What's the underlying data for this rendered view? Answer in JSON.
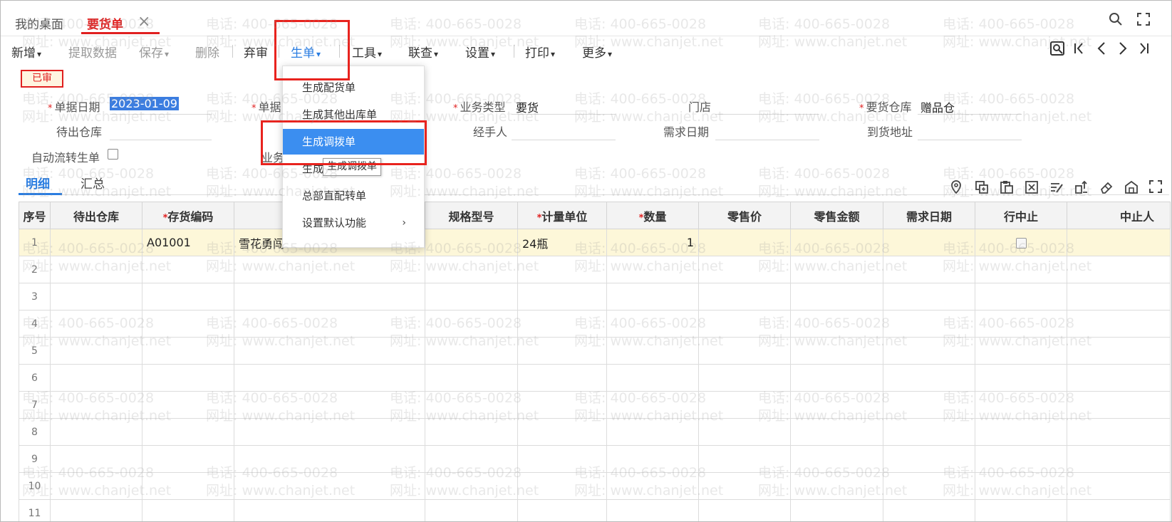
{
  "tabs": {
    "desktop": "我的桌面",
    "current": "要货单",
    "close_icon": "×",
    "search_icon": "search",
    "fullscreen_icon": "fullscreen"
  },
  "toolbar": {
    "add": "新增",
    "extract": "提取数据",
    "save": "保存",
    "delete": "删除",
    "unaudit": "弃审",
    "generate": "生单",
    "tools": "工具",
    "linked_query": "联查",
    "settings": "设置",
    "print": "打印",
    "more": "更多",
    "nav": [
      "preview",
      "first",
      "prev",
      "next",
      "last"
    ]
  },
  "status_badge": "已审",
  "form": {
    "doc_date_label": "单据日期",
    "doc_date_value": "2023-01-09",
    "doc_no_label": "单据",
    "biz_type_label": "业务类型",
    "biz_type_value": "要货",
    "store_label": "门店",
    "req_warehouse_label": "要货仓库",
    "req_warehouse_value": "赠品仓",
    "out_warehouse_label": "待出仓库",
    "handler_label": "经手人",
    "demand_date_label": "需求日期",
    "arrival_address_label": "到货地址",
    "auto_flow_label": "自动流转生单",
    "biz_partial_label": "业务"
  },
  "detail_tabs": [
    "明细",
    "汇总"
  ],
  "grid_icons": [
    "location-icon",
    "copy-row-icon",
    "paste-icon",
    "delete-row-icon",
    "batch-edit-icon",
    "split-icon",
    "eraser-icon",
    "warehouse-icon",
    "expand-icon"
  ],
  "grid": {
    "headers": [
      "序号",
      "待出仓库",
      "存货编码",
      "",
      "规格型号",
      "计量单位",
      "数量",
      "零售价",
      "零售金额",
      "需求日期",
      "行中止",
      "中止人"
    ],
    "required": [
      false,
      false,
      true,
      false,
      false,
      true,
      true,
      false,
      false,
      false,
      false,
      false
    ],
    "row1": {
      "idx": "1",
      "out_warehouse": "",
      "code": "A01001",
      "name": "雪花勇闯",
      "unit": "24瓶",
      "qty": "1"
    },
    "row_numbers": [
      "2",
      "3",
      "4",
      "5",
      "6",
      "7",
      "8",
      "9",
      "10",
      "11"
    ]
  },
  "dropdown": {
    "items": [
      "生成配货单",
      "生成其他出库单",
      "生成调拨单",
      "生成",
      "总部直配转单",
      "设置默认功能"
    ],
    "highlighted_index": 2
  },
  "tooltip": "生成调拨单",
  "watermark": {
    "phone": "电话: 400-665-0028",
    "site": "网址: www.chanjet.net"
  }
}
